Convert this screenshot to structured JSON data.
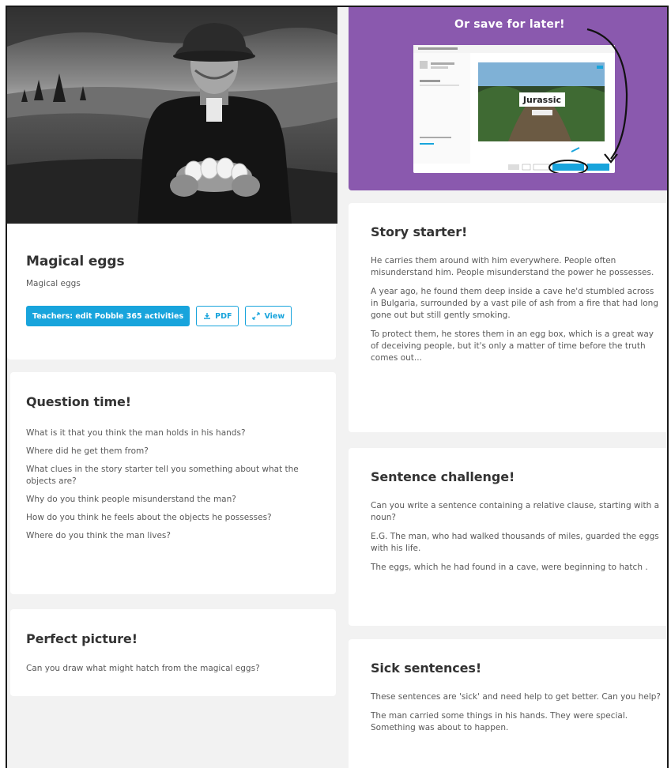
{
  "activity": {
    "title": "Magical eggs",
    "subtitle": "Magical eggs",
    "buttons": {
      "teachers": "Teachers: edit Pobble 365 activities",
      "pdf": "PDF",
      "view": "View"
    }
  },
  "promo": {
    "heading": "Or save for later!",
    "preview_word": "Jurassic",
    "accent": "#8a59ae"
  },
  "question_time": {
    "title": "Question time!",
    "items": [
      "What is it that you think the man holds in his hands?",
      "Where did he get them from?",
      "What clues in the story starter tell you something about what the objects are?",
      "Why do you think people misunderstand the man?",
      "How do you think he feels about the objects he possesses?",
      "Where do you think the man lives?"
    ]
  },
  "perfect_picture": {
    "title": "Perfect picture!",
    "text": "Can you draw what might hatch from the magical eggs?"
  },
  "story_starter": {
    "title": "Story starter!",
    "paragraphs": [
      "He carries them around with him everywhere. People often misunderstand him. People misunderstand the power he possesses.",
      "A year ago, he found them deep inside a cave he'd stumbled across in Bulgaria, surrounded by a vast pile of ash from a fire that had long gone out but still gently smoking.",
      "To protect them, he stores them in an egg box, which is a great way of deceiving people, but it's only a matter of time before the truth comes out..."
    ]
  },
  "sentence_challenge": {
    "title": "Sentence challenge!",
    "paragraphs": [
      "Can you write a sentence containing a relative clause, starting with a noun?",
      "E.G. The man, who had walked thousands of miles, guarded the eggs with his life.",
      "The eggs, which he had found in a cave, were beginning to hatch ."
    ]
  },
  "sick_sentences": {
    "title": "Sick sentences!",
    "paragraphs": [
      "These sentences are 'sick' and need help to get better. Can you help?",
      "The man carried some things in his hands. They were special. Something was about to happen."
    ]
  },
  "colors": {
    "button_blue": "#18a4dc",
    "page_bg": "#f2f2f2"
  }
}
